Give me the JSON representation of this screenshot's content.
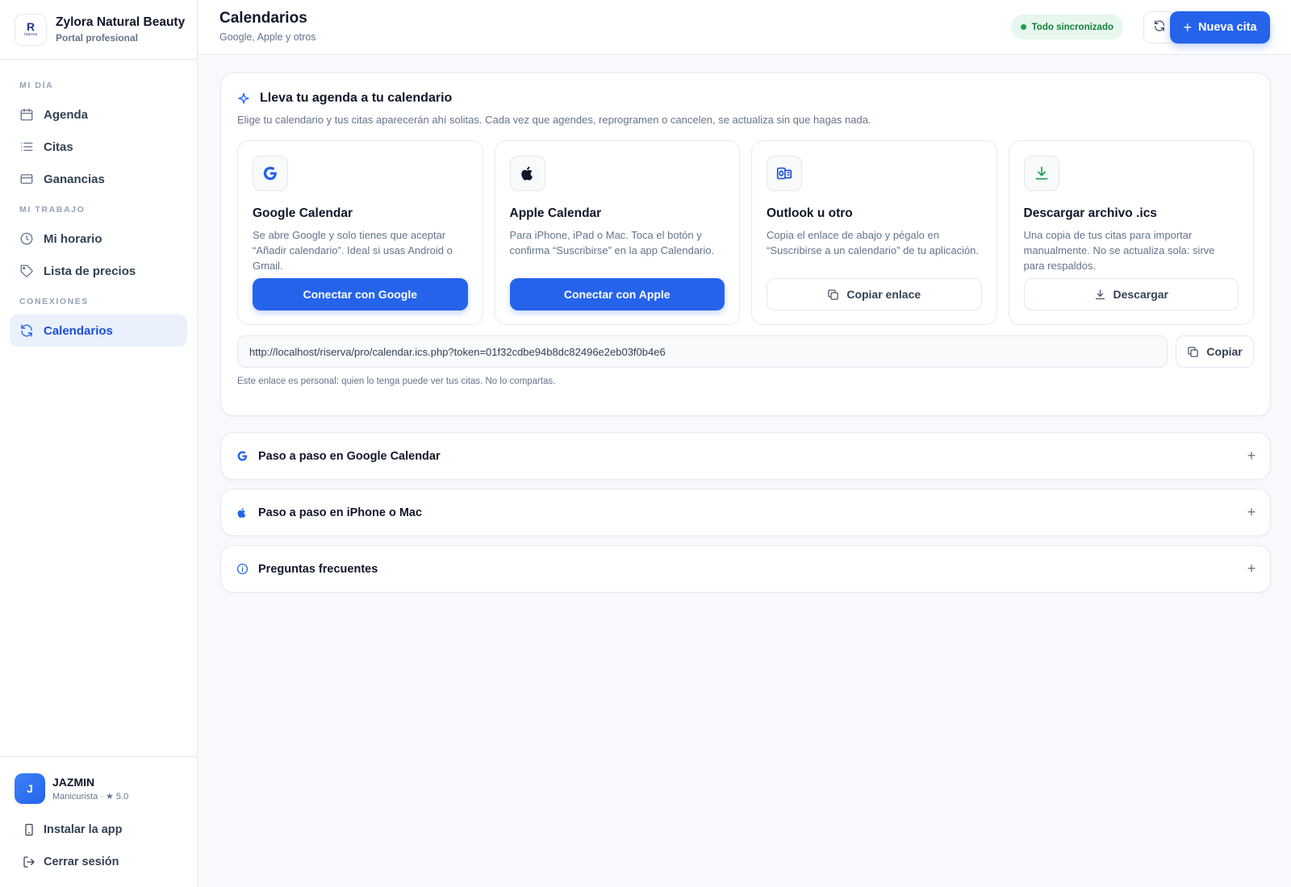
{
  "brand": {
    "name": "Zylora Natural Beauty",
    "subtitle": "Portal profesional",
    "logo_letter": "R",
    "logo_word": "riserva"
  },
  "sidebar": {
    "sections": [
      "MI DÍA",
      "MI TRABAJO",
      "CONEXIONES"
    ],
    "items": [
      {
        "label": "Agenda",
        "icon": "calendar-icon"
      },
      {
        "label": "Citas",
        "icon": "list-icon"
      },
      {
        "label": "Ganancias",
        "icon": "wallet-icon"
      },
      {
        "label": "Mi horario",
        "icon": "clock-icon"
      },
      {
        "label": "Lista de precios",
        "icon": "tag-icon"
      },
      {
        "label": "Calendarios",
        "icon": "sync-icon",
        "active": true
      }
    ],
    "user": {
      "initial": "J",
      "name": "JAZMIN",
      "role": "Manicurista · ★ 5.0"
    },
    "install_label": "Instalar la app",
    "logout_label": "Cerrar sesión"
  },
  "header": {
    "title": "Calendarios",
    "subtitle": "Google, Apple y otros",
    "sync_status": "Todo sincronizado",
    "new_button": "Nueva cita"
  },
  "hero": {
    "title": "Lleva tu agenda a tu calendario",
    "description": "Elige tu calendario y tus citas aparecerán ahí solitas. Cada vez que agendes, reprogramen o cancelen, se actualiza sin que hagas nada.",
    "options": [
      {
        "icon": "google-icon",
        "title": "Google Calendar",
        "description": "Se abre Google y solo tienes que aceptar “Añadir calendario”. Ideal si usas Android o Gmail.",
        "button": "Conectar con Google"
      },
      {
        "icon": "apple-icon",
        "title": "Apple Calendar",
        "description": "Para iPhone, iPad o Mac. Toca el botón y confirma “Suscribirse” en la app Calendario.",
        "button": "Conectar con Apple"
      },
      {
        "icon": "outlook-icon",
        "title": "Outlook u otro",
        "description": "Copia el enlace de abajo y pégalo en “Suscribirse a un calendario” de tu aplicación.",
        "button": "Copiar enlace"
      },
      {
        "icon": "download-icon",
        "title": "Descargar archivo .ics",
        "description": "Una copia de tus citas para importar manualmente. No se actualiza sola: sirve para respaldos.",
        "button": "Descargar"
      }
    ],
    "feed_url": "http://localhost/riserva/pro/calendar.ics.php?token=01f32cdbe94b8dc82496e2eb03f0b4e6",
    "copy_label": "Copiar",
    "note": "Este enlace es personal: quien lo tenga puede ver tus citas. No lo compartas."
  },
  "accordions": [
    {
      "icon": "google-icon",
      "title": "Paso a paso en Google Calendar"
    },
    {
      "icon": "apple-icon",
      "title": "Paso a paso en iPhone o Mac"
    },
    {
      "icon": "info-icon",
      "title": "Preguntas frecuentes"
    }
  ],
  "colors": {
    "accent": "#2563eb",
    "active_bg": "#eaf1fd",
    "sync_bg": "#e7f7ee",
    "sync_text": "#15803d",
    "download_icon": "#16a34a"
  }
}
